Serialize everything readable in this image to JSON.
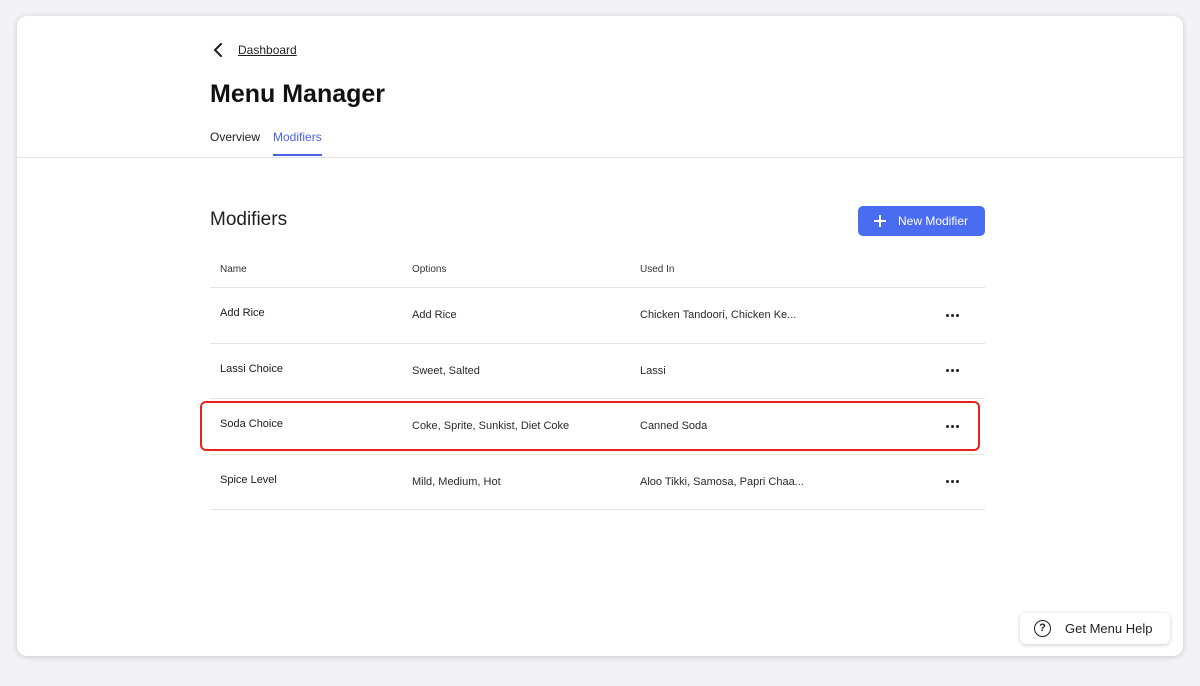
{
  "breadcrumb": {
    "link": "Dashboard"
  },
  "page": {
    "title": "Menu Manager"
  },
  "tabs": [
    {
      "label": "Overview",
      "active": false
    },
    {
      "label": "Modifiers",
      "active": true
    }
  ],
  "section": {
    "title": "Modifiers",
    "new_button": "New Modifier"
  },
  "table": {
    "headers": [
      "Name",
      "Options",
      "Used In"
    ],
    "rows": [
      {
        "name": "Add Rice",
        "options": "Add Rice",
        "used_in": "Chicken Tandoori, Chicken Ke..."
      },
      {
        "name": "Lassi Choice",
        "options": "Sweet, Salted",
        "used_in": "Lassi"
      },
      {
        "name": "Soda Choice",
        "options": "Coke, Sprite, Sunkist, Diet Coke",
        "used_in": "Canned Soda",
        "highlighted": true
      },
      {
        "name": "Spice Level",
        "options": "Mild, Medium, Hot",
        "used_in": "Aloo Tikki, Samosa, Papri Chaa..."
      }
    ]
  },
  "help": {
    "label": "Get Menu Help",
    "icon": "question-circle-icon"
  },
  "colors": {
    "accent": "#4a6cf0",
    "highlight_border": "#e8231c"
  }
}
